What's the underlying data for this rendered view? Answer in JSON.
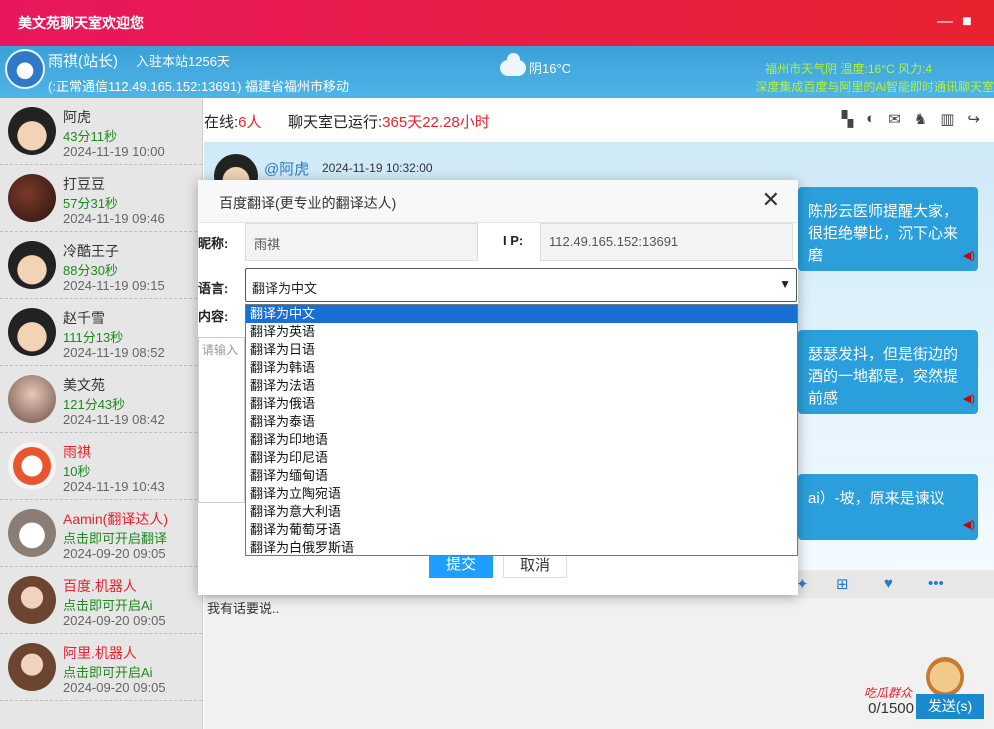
{
  "window": {
    "title": "美文苑聊天室欢迎您",
    "minimize": "—",
    "maximize": "■"
  },
  "header": {
    "name": "雨祺(站长)",
    "joined": "入驻本站1256天",
    "status": "(:正常通信112.49.165.152:13691) 福建省福州市移动",
    "weather": "阴16°C",
    "right_line1": "福州市天气阴 温度:16°C 风力:4",
    "right_line2": "深度集成百度与阿里的Ai智能即时通讯聊天室"
  },
  "topbar": {
    "online_label": "在线:",
    "online_count": "6人",
    "runtime_label": "聊天室已运行:",
    "runtime_value": "365天22.28小时",
    "icons": [
      "grid-icon",
      "toggle-icon",
      "mail-icon",
      "bell-icon",
      "trash-icon",
      "share-icon"
    ]
  },
  "users": [
    {
      "name": "阿虎",
      "time": "43分11秒",
      "date": "2024-11-19 10:00",
      "name_color": "#333333"
    },
    {
      "name": "打豆豆",
      "time": "57分31秒",
      "date": "2024-11-19 09:46",
      "name_color": "#333333"
    },
    {
      "name": "冷酷王子",
      "time": "88分30秒",
      "date": "2024-11-19 09:15",
      "name_color": "#333333"
    },
    {
      "name": "赵千雪",
      "time": "111分13秒",
      "date": "2024-11-19 08:52",
      "name_color": "#333333"
    },
    {
      "name": "美文苑",
      "time": "121分43秒",
      "date": "2024-11-19 08:42",
      "name_color": "#333333"
    },
    {
      "name": "雨祺",
      "time": "10秒",
      "date": "2024-11-19 10:43",
      "name_color": "#e8232f"
    },
    {
      "name": "Aamin(翻译达人)",
      "time": "点击即可开启翻译",
      "date": "2024-09-20 09:05",
      "name_color": "#e8232f"
    },
    {
      "name": "百度.机器人",
      "time": "点击即可开启Ai",
      "date": "2024-09-20 09:05",
      "name_color": "#e8232f"
    },
    {
      "name": "阿里.机器人",
      "time": "点击即可开启Ai",
      "date": "2024-09-20 09:05",
      "name_color": "#e8232f"
    }
  ],
  "chat": {
    "message_name": "@阿虎",
    "message_time": "2024-11-19 10:32:00",
    "bubble1": "陈彤云医师提醒大家，很拒绝攀比，沉下心来磨",
    "bubble2": "瑟瑟发抖，但是街边的酒的一地都是，突然提前感",
    "bubble3": "ai）-坡，原来是谏议"
  },
  "input": {
    "placeholder": "我有话要说..",
    "counter": "0/1500",
    "send": "发送(s)",
    "melon": "吃瓜群众"
  },
  "modal": {
    "title": "百度翻译(更专业的翻译达人)",
    "close": "✕",
    "nick_label": "昵称:",
    "nick_value": "雨祺",
    "ip_label": "I P:",
    "ip_value": "112.49.165.152:13691",
    "lang_label": "语言:",
    "lang_selected": "翻译为中文",
    "content_label": "内容:",
    "content_placeholder": "请输入",
    "submit": "提交",
    "cancel": "取消",
    "options": [
      "翻译为中文",
      "翻译为英语",
      "翻译为日语",
      "翻译为韩语",
      "翻译为法语",
      "翻译为俄语",
      "翻译为泰语",
      "翻译为印地语",
      "翻译为印尼语",
      "翻译为缅甸语",
      "翻译为立陶宛语",
      "翻译为意大利语",
      "翻译为葡萄牙语",
      "翻译为白俄罗斯语"
    ]
  }
}
